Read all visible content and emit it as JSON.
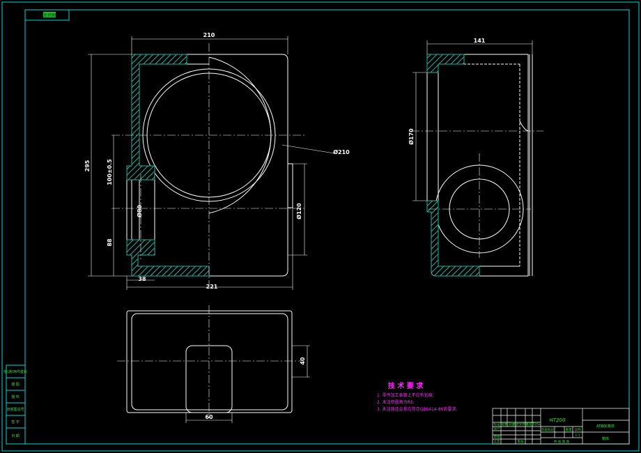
{
  "sheet": {
    "corner_tag": "反转图"
  },
  "front_view": {
    "dim_top": "210",
    "dim_left": "295",
    "dim_center_offset": "100±0.5",
    "dim_lower": "88",
    "dim_bottom_small": "38",
    "dim_bottom": "221",
    "dim_circle": "Ø210",
    "dim_bore_small": "Ø80",
    "dim_bore_right": "Ø120"
  },
  "side_view": {
    "dim_top": "141",
    "dim_left": "Ø170"
  },
  "top_view": {
    "dim_right": "40",
    "dim_bottom": "60"
  },
  "tech_requirements": {
    "title": "技 术 要 求",
    "items": [
      "1. 零件加工表面上不应有划痕;",
      "2. 未注倒圆角为R3;",
      "3. 未注铸造公差应符合GB6414-86的要求."
    ]
  },
  "left_strip": {
    "labels": [
      "借(通)用件登记",
      "描 图",
      "描 校",
      "旧底图总号",
      "签 字",
      "日 期"
    ]
  },
  "title_block": {
    "material": "HT200",
    "part_name": "AT蜗轮箱体",
    "part_no": "箱体",
    "row_labels": [
      "标记",
      "处数",
      "分区",
      "更改文件号",
      "签名",
      "年月日"
    ],
    "role_labels": [
      "设计",
      "审核",
      "工艺",
      "批准"
    ],
    "stage_labels": [
      "阶段标记",
      "重量",
      "比例"
    ],
    "scale": "1:1",
    "sheet_info": "共 张 第 张"
  }
}
